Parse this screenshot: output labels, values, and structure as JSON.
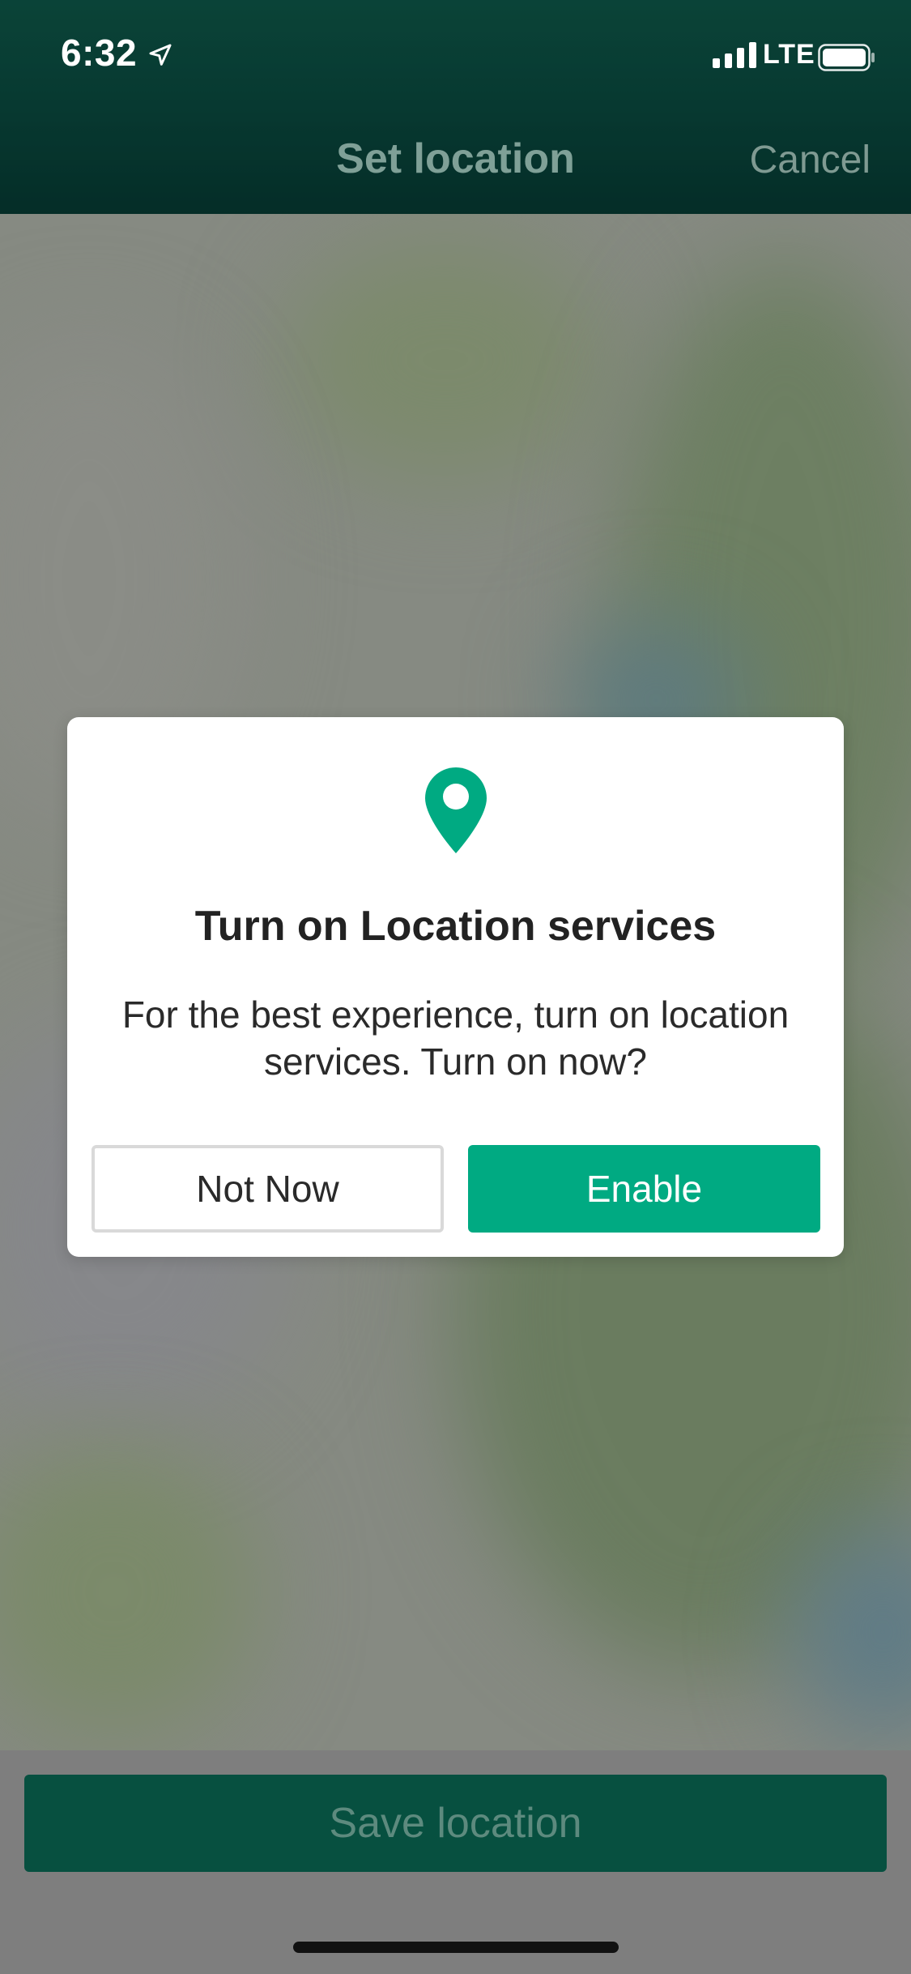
{
  "status_bar": {
    "time": "6:32",
    "network": "LTE",
    "location_icon": "location-arrow-icon",
    "signal_icon": "signal-bars-icon",
    "battery_icon": "battery-icon"
  },
  "header": {
    "title": "Set location",
    "cancel_label": "Cancel"
  },
  "dialog": {
    "icon": "map-pin-icon",
    "title": "Turn on Location services",
    "body": "For the best experience, turn on location services. Turn on now?",
    "secondary_button": "Not Now",
    "primary_button": "Enable"
  },
  "footer": {
    "save_label": "Save location"
  },
  "colors": {
    "brand_green": "#00aa82",
    "header_green": "#0a4e43",
    "save_button": "#075040"
  }
}
